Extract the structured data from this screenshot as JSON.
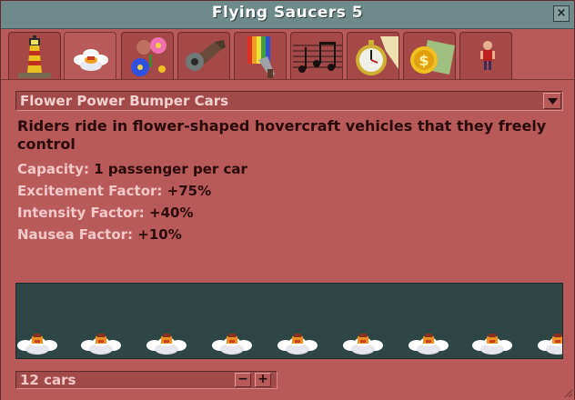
{
  "window": {
    "title": "Flying Saucers 5",
    "close_label": "×"
  },
  "tabs": [
    {
      "name": "main",
      "icon": "lighthouse-icon",
      "active": false
    },
    {
      "name": "vehicle",
      "icon": "flower-car-icon",
      "active": true
    },
    {
      "name": "operating",
      "icon": "flowers-icon",
      "active": false
    },
    {
      "name": "maintenance",
      "icon": "wrench-icon",
      "active": false
    },
    {
      "name": "colour",
      "icon": "paint-brush-icon",
      "active": false
    },
    {
      "name": "music",
      "icon": "music-notes-icon",
      "active": false
    },
    {
      "name": "measurements",
      "icon": "stopwatch-icon",
      "active": false
    },
    {
      "name": "income",
      "icon": "coin-icon",
      "active": false
    },
    {
      "name": "customers",
      "icon": "guest-icon",
      "active": false
    }
  ],
  "vehicle": {
    "selected_type": "Flower Power Bumper Cars",
    "description": "Riders ride in flower-shaped hovercraft vehicles that they freely control",
    "stats": [
      {
        "label": "Capacity:",
        "value": "1 passenger per car"
      },
      {
        "label": "Excitement Factor:",
        "value": "+75%"
      },
      {
        "label": "Intensity Factor:",
        "value": "+40%"
      },
      {
        "label": "Nausea Factor:",
        "value": "+10%"
      }
    ],
    "cars_count": "12 cars",
    "decrease_label": "−",
    "increase_label": "+"
  },
  "colors": {
    "window_bg": "#b85a5a",
    "title_bar": "#6f8a8a",
    "preview_bg": "#2f4646",
    "label_text": "#f2c8c8",
    "value_text": "#2a0a0a"
  }
}
